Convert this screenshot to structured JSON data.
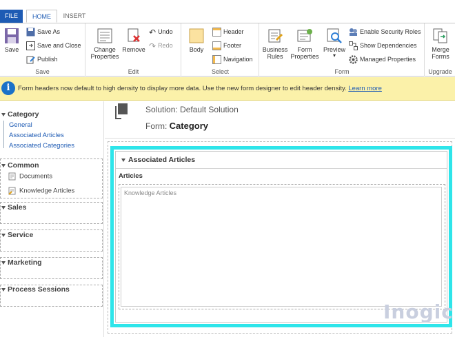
{
  "tabs": {
    "file": "FILE",
    "home": "HOME",
    "insert": "INSERT"
  },
  "ribbon": {
    "save_group": {
      "label": "Save",
      "save": "Save",
      "save_as": "Save As",
      "save_close": "Save and Close",
      "publish": "Publish"
    },
    "edit_group": {
      "label": "Edit",
      "change_properties": "Change Properties",
      "remove": "Remove",
      "undo": "Undo",
      "redo": "Redo"
    },
    "select_group": {
      "label": "Select",
      "body": "Body",
      "header": "Header",
      "footer": "Footer",
      "navigation": "Navigation"
    },
    "form_group": {
      "label": "Form",
      "business_rules": "Business Rules",
      "form_properties": "Form Properties",
      "preview": "Preview",
      "enable_security_roles": "Enable Security Roles",
      "show_dependencies": "Show Dependencies",
      "managed_properties": "Managed Properties"
    },
    "upgrade_group": {
      "label": "Upgrade",
      "merge_forms": "Merge Forms"
    }
  },
  "infobar": {
    "message": "Form headers now default to high density to display more data. Use the new form designer to edit header density.",
    "link": "Learn more"
  },
  "nav": {
    "category": {
      "title": "Category",
      "items": [
        "General",
        "Associated Articles",
        "Associated Categories"
      ]
    },
    "common": {
      "title": "Common",
      "items": [
        "Documents",
        "Knowledge Articles"
      ]
    },
    "sales": "Sales",
    "service": "Service",
    "marketing": "Marketing",
    "process_sessions": "Process Sessions"
  },
  "form": {
    "solution": "Solution: Default Solution",
    "form_prefix": "Form: ",
    "form_name": "Category",
    "section_title": "Associated Articles",
    "subgrid_label": "Articles",
    "subgrid_placeholder": "Knowledge Articles"
  },
  "watermark": "Inogic",
  "colors": {
    "accent": "#1e5bb4",
    "highlight": "#2ee5ea",
    "infobar": "#fbf1a9"
  }
}
